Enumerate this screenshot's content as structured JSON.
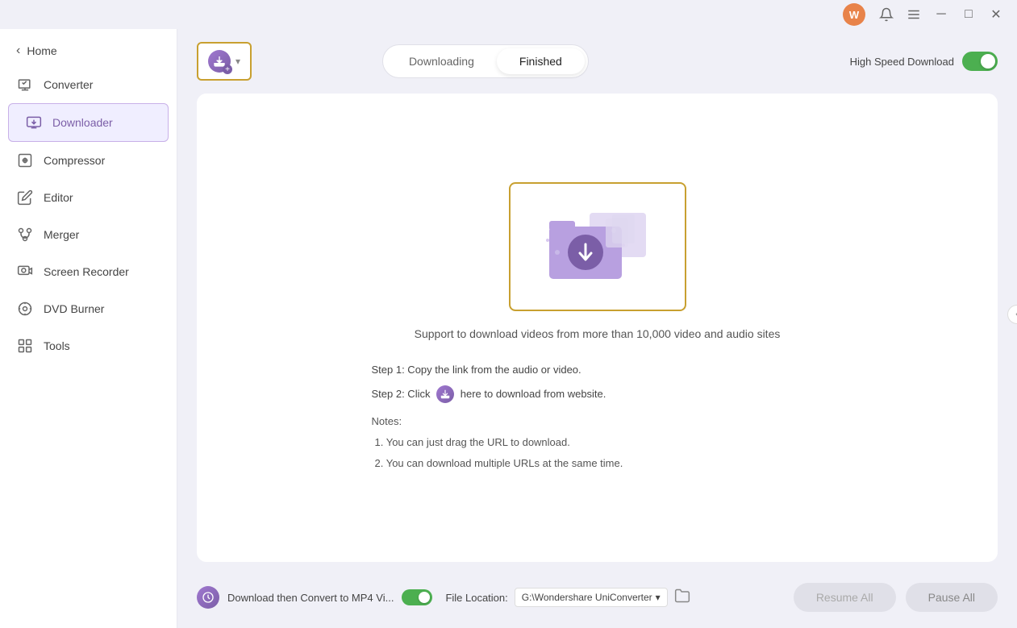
{
  "titlebar": {
    "avatar_letter": "W",
    "min_label": "─",
    "max_label": "□",
    "close_label": "✕"
  },
  "sidebar": {
    "back_label": "Home",
    "items": [
      {
        "id": "converter",
        "label": "Converter",
        "active": false
      },
      {
        "id": "downloader",
        "label": "Downloader",
        "active": true
      },
      {
        "id": "compressor",
        "label": "Compressor",
        "active": false
      },
      {
        "id": "editor",
        "label": "Editor",
        "active": false
      },
      {
        "id": "merger",
        "label": "Merger",
        "active": false
      },
      {
        "id": "screen-recorder",
        "label": "Screen Recorder",
        "active": false
      },
      {
        "id": "dvd-burner",
        "label": "DVD Burner",
        "active": false
      },
      {
        "id": "tools",
        "label": "Tools",
        "active": false
      }
    ]
  },
  "toolbar": {
    "add_btn_chevron": "▾",
    "tab_downloading": "Downloading",
    "tab_finished": "Finished",
    "speed_label": "High Speed Download"
  },
  "download_area": {
    "support_text": "Support to download videos from more than 10,000 video and audio sites",
    "step1": "Step 1: Copy the link from the audio or video.",
    "step2_prefix": "Step 2: Click",
    "step2_suffix": "here to download from website.",
    "notes_header": "Notes:",
    "note1": "1. You can just drag the URL to download.",
    "note2": "2. You can download multiple URLs at the same time."
  },
  "bottom_bar": {
    "convert_label": "Download then Convert to MP4 Vi...",
    "file_location_label": "File Location:",
    "file_path": "G:\\Wondershare UniConverter ▾",
    "resume_label": "Resume All",
    "pause_label": "Pause All"
  }
}
